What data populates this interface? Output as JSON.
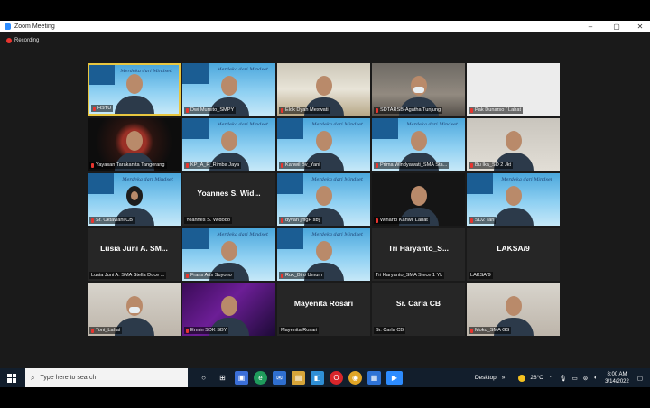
{
  "window": {
    "title": "Zoom Meeting",
    "minimize": "–",
    "maximize": "▢",
    "close": "✕"
  },
  "recording": "Recording",
  "banner_text": "Merdeka dari Mindset",
  "participants": [
    {
      "name": "HSTU",
      "video": true,
      "bg": "banner",
      "active": true
    },
    {
      "name": "Dwi Mursito_SMPY",
      "video": true,
      "bg": "banner"
    },
    {
      "name": "Elok Dyah Meswati",
      "video": true,
      "bg": "living"
    },
    {
      "name": "SDTARSB-Agatha Tunjung",
      "video": true,
      "bg": "office",
      "mask": true
    },
    {
      "name": "Pak Dunarso / Lahat",
      "video": true,
      "bg": "white"
    },
    {
      "name": "Yayasan Tarakanita Tangerang",
      "video": true,
      "bg": "red"
    },
    {
      "name": "KP_A_R_Rimba Jaya",
      "video": true,
      "bg": "banner"
    },
    {
      "name": "Kanwil Bv_Yani",
      "video": true,
      "bg": "banner"
    },
    {
      "name": "Prima Windyawati_SMA Sta...",
      "video": true,
      "bg": "banner"
    },
    {
      "name": "Bu Ika_SD 2 Jkt",
      "video": true,
      "bg": "room2"
    },
    {
      "name": "Sr. Oktaviani CB",
      "video": true,
      "bg": "banner",
      "hijab": true
    },
    {
      "name": "Yoannes S. Widodo",
      "video": false,
      "display": "Yoannes S. Wid..."
    },
    {
      "name": "dyvan jmgP sby",
      "video": true,
      "bg": "banner"
    },
    {
      "name": "Winarto Kanwil Lahat",
      "video": true,
      "bg": "dark"
    },
    {
      "name": "SD2 Tarl",
      "video": true,
      "bg": "banner"
    },
    {
      "name": "Lusia Juni A. SMA Stella Duce ...",
      "video": false,
      "display": "Lusia Juni A. SM..."
    },
    {
      "name": "Frans Aris Suyono",
      "video": true,
      "bg": "banner"
    },
    {
      "name": "Ruk_Biro Umum",
      "video": true,
      "bg": "banner"
    },
    {
      "name": "Tri Haryanto_SMA Stece 1 Yk",
      "video": false,
      "display": "Tri Haryanto_S..."
    },
    {
      "name": "LAKSA/9",
      "video": false,
      "display": "LAKSA/9"
    },
    {
      "name": "Toni_Lahat",
      "video": true,
      "bg": "room",
      "mask": true
    },
    {
      "name": "Ermin SDK SBY",
      "video": true,
      "bg": "purple"
    },
    {
      "name": "Mayenita Rosari",
      "video": false,
      "display": "Mayenita Rosari"
    },
    {
      "name": "Sr. Carla CB",
      "video": false,
      "display": "Sr. Carla CB"
    },
    {
      "name": "Moko_SMA GS",
      "video": true,
      "bg": "room"
    }
  ],
  "taskbar": {
    "search_placeholder": "Type here to search",
    "desktop_label": "Desktop",
    "temperature": "28°C",
    "time": "8:00 AM",
    "date": "3/14/2022"
  }
}
